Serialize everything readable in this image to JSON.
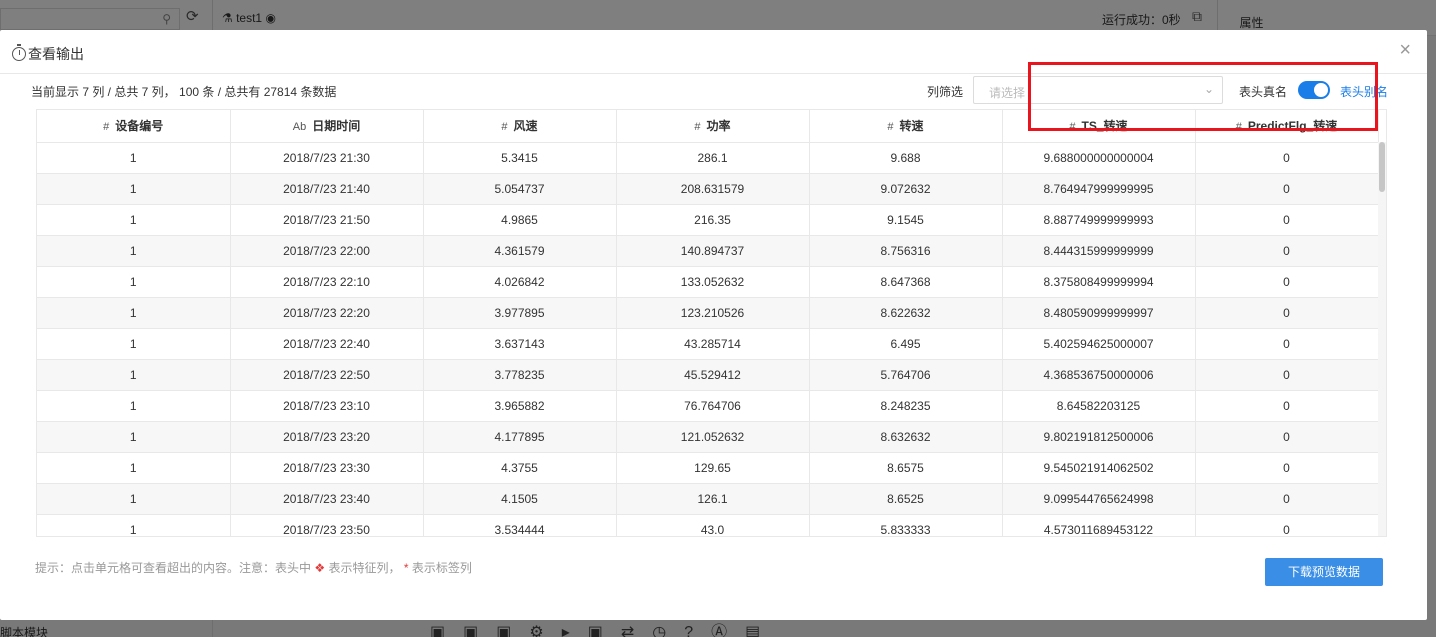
{
  "background": {
    "tab_title": "test1",
    "run_status": "运行成功：0秒",
    "properties_label": "属性",
    "bottom_label": "脚本模块"
  },
  "modal": {
    "title": "查看输出",
    "close_label": "×",
    "info": "当前显示 7 列 / 总共 7 列， 100 条 / 总共有 27814 条数据",
    "filter_label": "列筛选",
    "filter_placeholder": "请选择",
    "toggle_left_label": "表头真名",
    "toggle_right_label": "表头别名",
    "toggle_on": true,
    "hint_prefix": "提示：点击单元格可查看超出的内容。注意：表头中",
    "hint_feature": "表示特征列，",
    "hint_star": "*",
    "hint_label": "表示标签列",
    "download_label": "下载预览数据"
  },
  "table": {
    "columns": [
      {
        "type": "#",
        "name": "设备编号"
      },
      {
        "type": "Ab",
        "name": "日期时间"
      },
      {
        "type": "#",
        "name": "风速"
      },
      {
        "type": "#",
        "name": "功率"
      },
      {
        "type": "#",
        "name": "转速"
      },
      {
        "type": "#",
        "name": "TS_转速"
      },
      {
        "type": "#",
        "name": "PredictFlg_转速"
      }
    ],
    "rows": [
      [
        "1",
        "2018/7/23 21:30",
        "5.3415",
        "286.1",
        "9.688",
        "9.688000000000004",
        "0"
      ],
      [
        "1",
        "2018/7/23 21:40",
        "5.054737",
        "208.631579",
        "9.072632",
        "8.764947999999995",
        "0"
      ],
      [
        "1",
        "2018/7/23 21:50",
        "4.9865",
        "216.35",
        "9.1545",
        "8.887749999999993",
        "0"
      ],
      [
        "1",
        "2018/7/23 22:00",
        "4.361579",
        "140.894737",
        "8.756316",
        "8.444315999999999",
        "0"
      ],
      [
        "1",
        "2018/7/23 22:10",
        "4.026842",
        "133.052632",
        "8.647368",
        "8.375808499999994",
        "0"
      ],
      [
        "1",
        "2018/7/23 22:20",
        "3.977895",
        "123.210526",
        "8.622632",
        "8.480590999999997",
        "0"
      ],
      [
        "1",
        "2018/7/23 22:40",
        "3.637143",
        "43.285714",
        "6.495",
        "5.402594625000007",
        "0"
      ],
      [
        "1",
        "2018/7/23 22:50",
        "3.778235",
        "45.529412",
        "5.764706",
        "4.368536750000006",
        "0"
      ],
      [
        "1",
        "2018/7/23 23:10",
        "3.965882",
        "76.764706",
        "8.248235",
        "8.64582203125",
        "0"
      ],
      [
        "1",
        "2018/7/23 23:20",
        "4.177895",
        "121.052632",
        "8.632632",
        "9.802191812500006",
        "0"
      ],
      [
        "1",
        "2018/7/23 23:30",
        "4.3755",
        "129.65",
        "8.6575",
        "9.545021914062502",
        "0"
      ],
      [
        "1",
        "2018/7/23 23:40",
        "4.1505",
        "126.1",
        "8.6525",
        "9.099544765624998",
        "0"
      ],
      [
        "1",
        "2018/7/23 23:50",
        "3.534444",
        "43.0",
        "5.833333",
        "4.573011689453122",
        "0"
      ]
    ]
  },
  "colors": {
    "accent": "#1a7ee8",
    "button": "#3a8ee6",
    "highlight": "#e8141e"
  }
}
